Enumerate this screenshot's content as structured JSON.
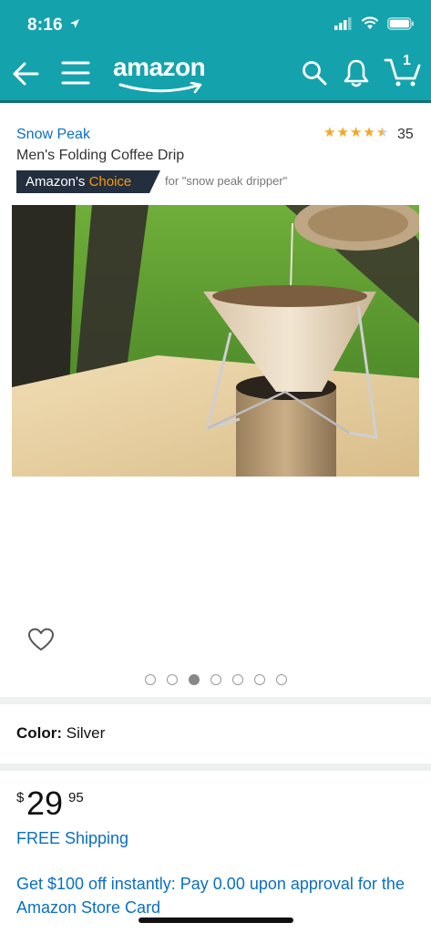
{
  "status": {
    "time": "8:16"
  },
  "nav": {
    "logo": "amazon",
    "cart_count": "1",
    "icons": [
      "back-arrow-icon",
      "hamburger-menu-icon",
      "search-icon",
      "bell-icon",
      "cart-icon"
    ]
  },
  "product": {
    "brand": "Snow Peak",
    "title": "Men's Folding Coffee Drip",
    "rating": 4.5,
    "rating_count": "35",
    "badge": {
      "prefix": "Amazon's",
      "highlight": "Choice",
      "query": "for \"snow peak dripper\""
    },
    "image_count": 7,
    "active_image": 3
  },
  "color": {
    "label": "Color:",
    "value": "Silver"
  },
  "price": {
    "symbol": "$",
    "whole": "29",
    "fraction": "95"
  },
  "shipping": "FREE Shipping",
  "promo": "Get $100 off instantly: Pay 0.00 upon approval for the Amazon Store Card",
  "colors": {
    "header": "#14a3ad",
    "link": "#0a6fc2",
    "star": "#f5a623",
    "choice": "#ff9900",
    "badge_bg": "#232f3e"
  }
}
